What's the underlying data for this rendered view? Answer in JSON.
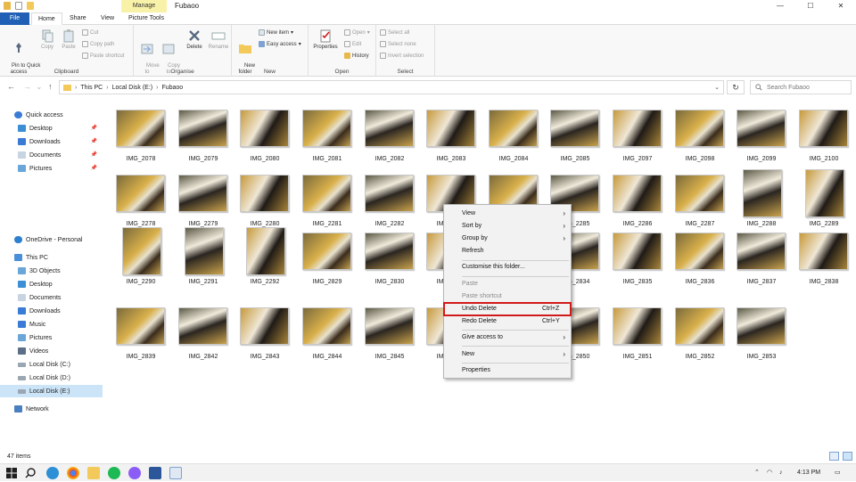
{
  "window": {
    "title": "Fubaoo",
    "context_tab": "Manage",
    "minimize": "—",
    "maximize": "☐",
    "close": "✕"
  },
  "tabs": {
    "file": "File",
    "home": "Home",
    "share": "Share",
    "view": "View",
    "picture_tools": "Picture Tools"
  },
  "ribbon": {
    "clipboard": {
      "label": "Clipboard",
      "pin": "Pin to Quick\naccess",
      "copy": "Copy",
      "paste": "Paste",
      "cut": "Cut",
      "copy_path": "Copy path",
      "paste_shortcut": "Paste shortcut"
    },
    "organise": {
      "label": "Organise",
      "move_to": "Move\nto",
      "copy_to": "Copy\nto",
      "delete": "Delete",
      "rename": "Rename"
    },
    "new": {
      "label": "New",
      "new_folder": "New\nfolder",
      "new_item": "New item",
      "easy_access": "Easy access"
    },
    "open": {
      "label": "Open",
      "properties": "Properties",
      "open": "Open",
      "edit": "Edit",
      "history": "History"
    },
    "select": {
      "label": "Select",
      "select_all": "Select all",
      "select_none": "Select none",
      "invert": "Invert selection"
    }
  },
  "address": {
    "back": "←",
    "forward": "→",
    "up": "↑",
    "recent": "⌄",
    "path": [
      "This PC",
      "Local Disk (E:)",
      "Fubaoo"
    ],
    "search_placeholder": "Search Fubaoo",
    "refresh": "↻"
  },
  "nav": {
    "quick_access": "Quick access",
    "qa_items": [
      "Desktop",
      "Downloads",
      "Documents",
      "Pictures"
    ],
    "onedrive": "OneDrive - Personal",
    "this_pc": "This PC",
    "pc_items": [
      "3D Objects",
      "Desktop",
      "Documents",
      "Downloads",
      "Music",
      "Pictures",
      "Videos",
      "Local Disk (C:)",
      "Local Disk (D:)",
      "Local Disk (E:)"
    ],
    "network": "Network"
  },
  "files": [
    "IMG_2078",
    "IMG_2079",
    "IMG_2080",
    "IMG_2081",
    "IMG_2082",
    "IMG_2083",
    "IMG_2084",
    "IMG_2085",
    "IMG_2097",
    "IMG_2098",
    "IMG_2099",
    "IMG_2100",
    "IMG_2278",
    "IMG_2279",
    "IMG_2280",
    "IMG_2281",
    "IMG_2282",
    "IMG_2283",
    "IMG_2284",
    "IMG_2285",
    "IMG_2286",
    "IMG_2287",
    "IMG_2288",
    "IMG_2289",
    "IMG_2290",
    "IMG_2291",
    "IMG_2292",
    "IMG_2829",
    "IMG_2830",
    "IMG_2831",
    "IMG_2832",
    "IMG_2834",
    "IMG_2835",
    "IMG_2836",
    "IMG_2837",
    "IMG_2838",
    "IMG_2839",
    "IMG_2842",
    "IMG_2843",
    "IMG_2844",
    "IMG_2845",
    "IMG_2846",
    "IMG_2848",
    "IMG_2850",
    "IMG_2851",
    "IMG_2852",
    "IMG_2853"
  ],
  "context_menu": {
    "view": "View",
    "sort_by": "Sort by",
    "group_by": "Group by",
    "refresh": "Refresh",
    "customise": "Customise this folder...",
    "paste": "Paste",
    "paste_shortcut": "Paste shortcut",
    "undo_delete": "Undo Delete",
    "undo_shortcut": "Ctrl+Z",
    "redo_delete": "Redo Delete",
    "redo_shortcut": "Ctrl+Y",
    "give_access": "Give access to",
    "new": "New",
    "properties": "Properties"
  },
  "status": {
    "count": "47 items"
  },
  "taskbar": {
    "time": "4:13 PM"
  },
  "colors": {
    "file_tab": "#1f5fb5",
    "selection": "#cce4f7",
    "highlight_box": "#d11a1a",
    "manage_band": "#f8f1a8"
  }
}
